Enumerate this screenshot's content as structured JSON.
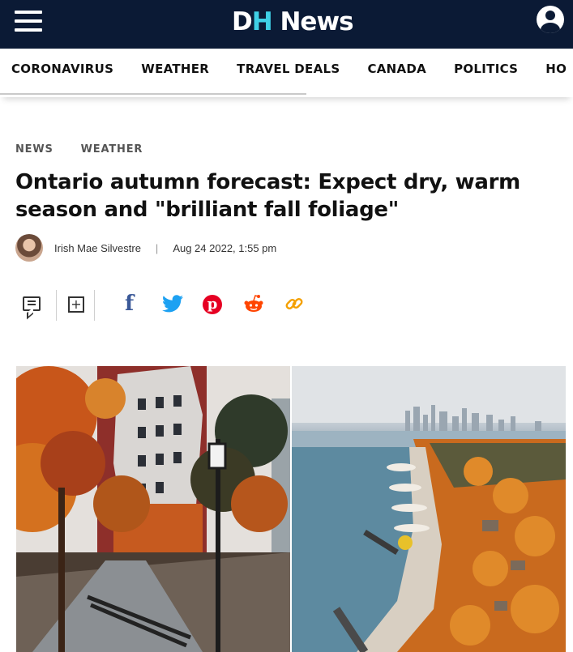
{
  "header": {
    "logo_d": "D",
    "logo_h": "H",
    "logo_news": "News"
  },
  "nav": {
    "items": [
      "CORONAVIRUS",
      "WEATHER",
      "TRAVEL DEALS",
      "CANADA",
      "POLITICS",
      "HO"
    ]
  },
  "article": {
    "breadcrumbs": [
      "NEWS",
      "WEATHER"
    ],
    "title": "Ontario autumn forecast: Expect dry, warm season and \"brilliant fall foliage\"",
    "author": "Irish Mae Silvestre",
    "separator": "|",
    "date": "Aug 24 2022, 1:55 pm"
  },
  "share": {
    "icons": [
      "comment-icon",
      "add-to-list-icon",
      "facebook-icon",
      "twitter-icon",
      "pinterest-icon",
      "reddit-icon",
      "link-icon"
    ],
    "colors": {
      "facebook": "#3b5998",
      "twitter": "#1da1f2",
      "pinterest": "#e60023",
      "reddit": "#ff4500",
      "link": "#f4a000"
    }
  },
  "theme": {
    "header_bg": "#0b1a35",
    "logo_accent": "#3fd0e6"
  }
}
